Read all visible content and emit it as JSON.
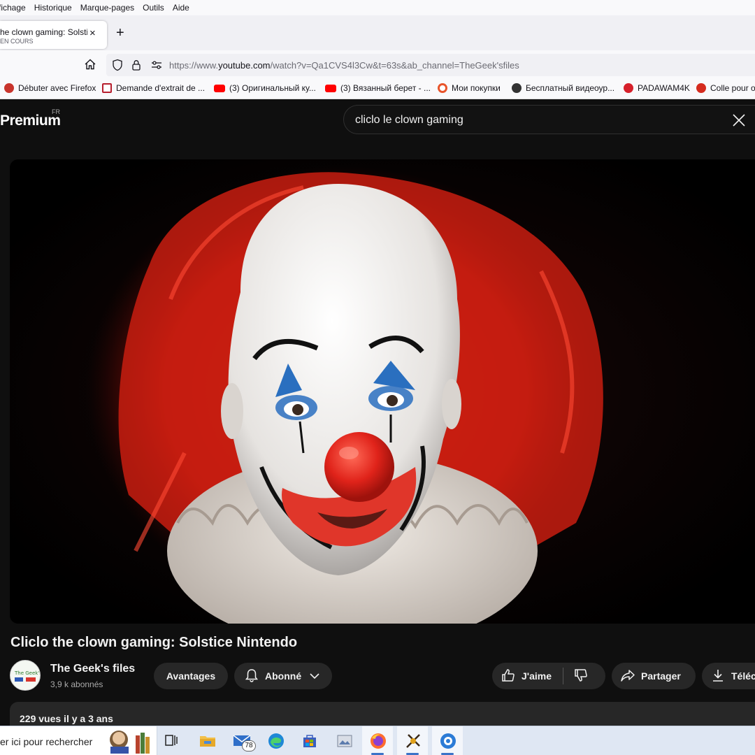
{
  "browser": {
    "menu": [
      "fichage",
      "Historique",
      "Marque-pages",
      "Outils",
      "Aide"
    ],
    "tab": {
      "title": "he clown gaming: Solstic",
      "subtitle": "EN COURS",
      "close": "×"
    },
    "new_tab": "+",
    "url_prefix": "https://www.",
    "url_domain": "youtube.com",
    "url_rest": "/watch?v=Qa1CVS4l3Cw&t=63s&ab_channel=TheGeek'sfiles",
    "bookmarks": [
      {
        "label": "Débuter avec Firefox",
        "color": "#c8342c"
      },
      {
        "label": "Demande d'extrait de ...",
        "color": "#b61e2d"
      },
      {
        "label": "(3) Оригинальный ку...",
        "color": "#ff0000"
      },
      {
        "label": "(3) Вязанный берет - ...",
        "color": "#ff0000"
      },
      {
        "label": "Мои покупки",
        "color": "#e8542b"
      },
      {
        "label": "Бесплатный видеоур...",
        "color": "#333333"
      },
      {
        "label": "PADAWAM4K",
        "color": "#d6202a"
      },
      {
        "label": "Colle pour o",
        "color": "#d52b1e"
      }
    ]
  },
  "youtube": {
    "logo": "Premium",
    "logo_region": "FR",
    "search_query": "cliclo le clown gaming",
    "video_title": "Cliclo the clown gaming: Solstice Nintendo",
    "channel": {
      "name": "The Geek's files",
      "subscribers": "3,9 k abonnés"
    },
    "buttons": {
      "avantages": "Avantages",
      "abonne": "Abonné",
      "like": "J'aime",
      "share": "Partager",
      "download": "Téléc"
    },
    "description_meta": "229 vues  il y a 3 ans"
  },
  "taskbar": {
    "search_text": "er ici pour rechercher",
    "mail_badge": "78"
  },
  "colors": {
    "yt_bg": "#0f0f0f",
    "pill_bg": "#272727",
    "taskbar": "#dfe7f3"
  }
}
